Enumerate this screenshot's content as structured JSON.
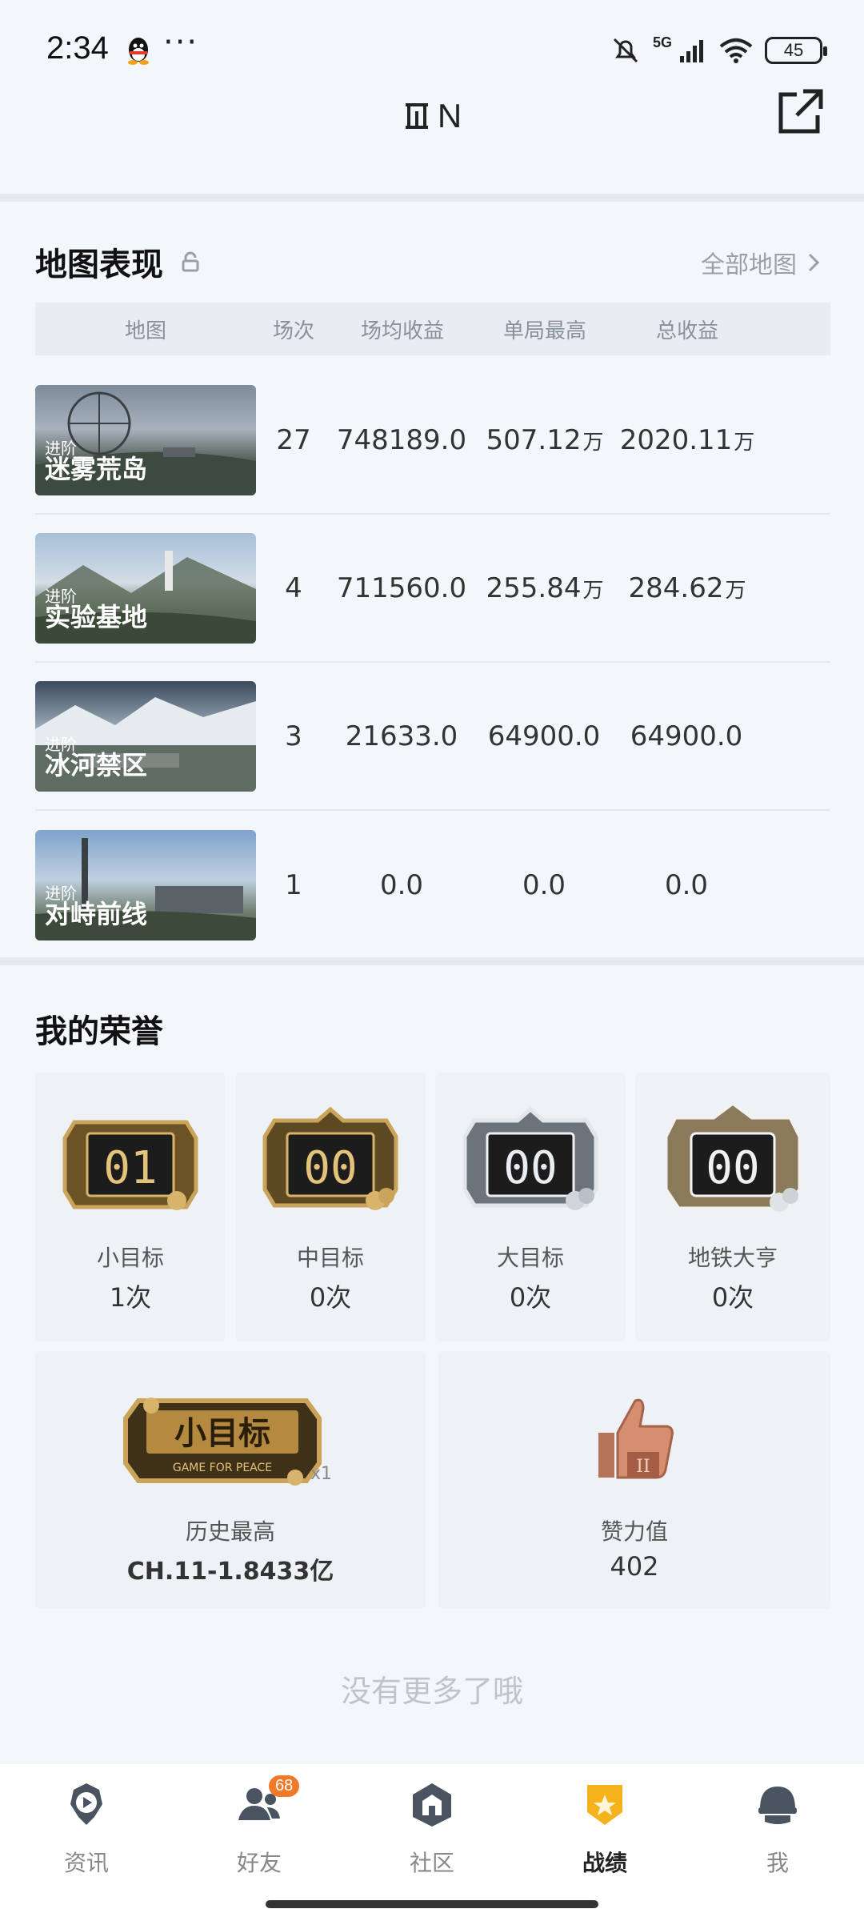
{
  "status": {
    "time": "2:34",
    "more": "···",
    "network": "5G",
    "battery": "45"
  },
  "header": {
    "title": "N"
  },
  "maps": {
    "title": "地图表现",
    "all_maps": "全部地图",
    "columns": [
      "地图",
      "场次",
      "场均收益",
      "单局最高",
      "总收益"
    ],
    "rows": [
      {
        "tag": "进阶",
        "name": "迷雾荒岛",
        "games": "27",
        "avg": "748189.0",
        "avg_unit": "",
        "max": "507.12",
        "max_unit": "万",
        "total": "2020.11",
        "total_unit": "万"
      },
      {
        "tag": "进阶",
        "name": "实验基地",
        "games": "4",
        "avg": "711560.0",
        "avg_unit": "",
        "max": "255.84",
        "max_unit": "万",
        "total": "284.62",
        "total_unit": "万"
      },
      {
        "tag": "进阶",
        "name": "冰河禁区",
        "games": "3",
        "avg": "21633.0",
        "avg_unit": "",
        "max": "64900.0",
        "max_unit": "",
        "total": "64900.0",
        "total_unit": ""
      },
      {
        "tag": "进阶",
        "name": "对峙前线",
        "games": "1",
        "avg": "0.0",
        "avg_unit": "",
        "max": "0.0",
        "max_unit": "",
        "total": "0.0",
        "total_unit": ""
      }
    ]
  },
  "honors": {
    "title": "我的荣誉",
    "items": [
      {
        "label": "小目标",
        "count": "1次",
        "badge_text": "01"
      },
      {
        "label": "中目标",
        "count": "0次",
        "badge_text": "00"
      },
      {
        "label": "大目标",
        "count": "0次",
        "badge_text": "00"
      },
      {
        "label": "地铁大亨",
        "count": "0次",
        "badge_text": "00"
      }
    ],
    "history": {
      "label": "历史最高",
      "value": "CH.11-1.8433亿",
      "badge_title": "小目标",
      "badge_sub": "GAME FOR PEACE",
      "badge_mult": "x1"
    },
    "likes": {
      "label": "赞力值",
      "value": "402"
    }
  },
  "no_more": "没有更多了哦",
  "nav": [
    {
      "label": "资讯",
      "icon": "news-icon"
    },
    {
      "label": "好友",
      "icon": "friends-icon",
      "badge": "68"
    },
    {
      "label": "社区",
      "icon": "community-icon"
    },
    {
      "label": "战绩",
      "icon": "record-icon"
    },
    {
      "label": "我",
      "icon": "profile-icon"
    }
  ]
}
